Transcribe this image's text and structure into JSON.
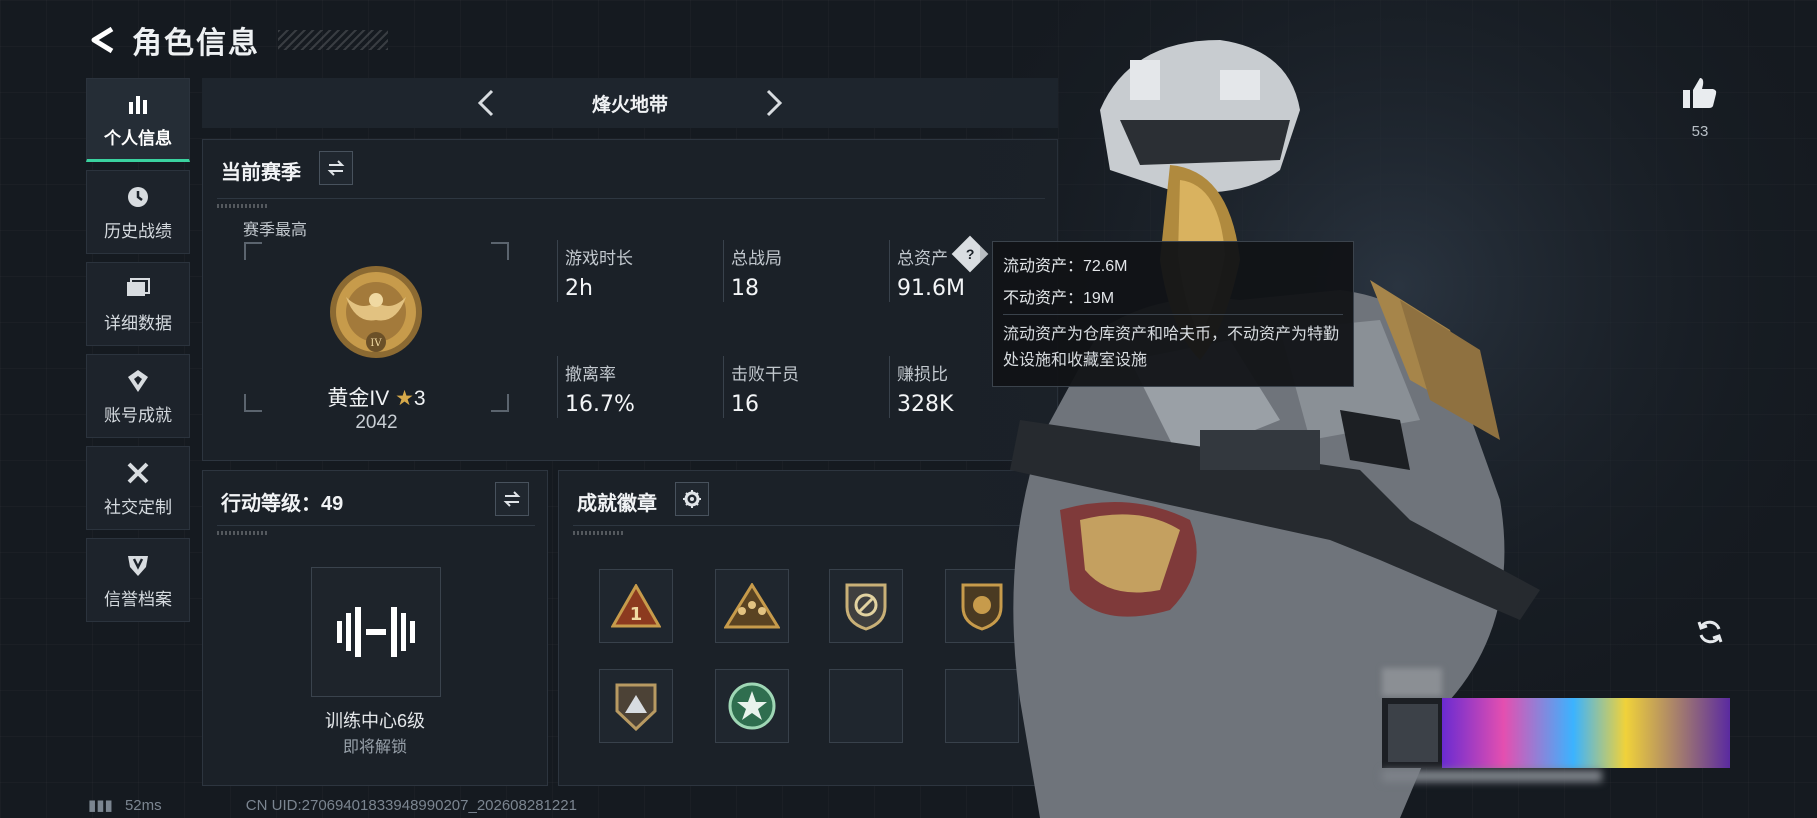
{
  "header": {
    "title": "角色信息"
  },
  "sidebar": {
    "items": [
      {
        "label": "个人信息",
        "icon": "bar-chart-icon",
        "active": true
      },
      {
        "label": "历史战绩",
        "icon": "clock-icon"
      },
      {
        "label": "详细数据",
        "icon": "folder-icon"
      },
      {
        "label": "账号成就",
        "icon": "medal-icon"
      },
      {
        "label": "社交定制",
        "icon": "tools-icon"
      },
      {
        "label": "信誉档案",
        "icon": "shield-icon"
      }
    ]
  },
  "mode": {
    "label": "烽火地带"
  },
  "season": {
    "title": "当前赛季",
    "best_label": "赛季最高",
    "rank_name": "黄金IV",
    "rank_stars": "3",
    "rank_score": "2042",
    "stats": [
      {
        "label": "游戏时长",
        "value": "2h"
      },
      {
        "label": "总战局",
        "value": "18"
      },
      {
        "label": "总资产",
        "value": "91.6M"
      },
      {
        "label": "撤离率",
        "value": "16.7%"
      },
      {
        "label": "击败干员",
        "value": "16"
      },
      {
        "label": "赚损比",
        "value": "328K"
      }
    ]
  },
  "tooltip": {
    "liquid": "流动资产：72.6M",
    "fixed": "不动资产：19M",
    "desc": "流动资产为仓库资产和哈夫币，不动资产为特勤处设施和收藏室设施"
  },
  "action_level": {
    "title": "行动等级：49",
    "training_label": "训练中心6级",
    "status": "即将解锁"
  },
  "achievements": {
    "title": "成就徽章"
  },
  "likes": {
    "count": "53"
  },
  "footer": {
    "ping": "52ms",
    "uid": "CN UID:27069401833948990207_202608281221"
  },
  "colors": {
    "accent": "#3ad29f",
    "gold": "#c79b4b",
    "panel": "#1b2128"
  }
}
